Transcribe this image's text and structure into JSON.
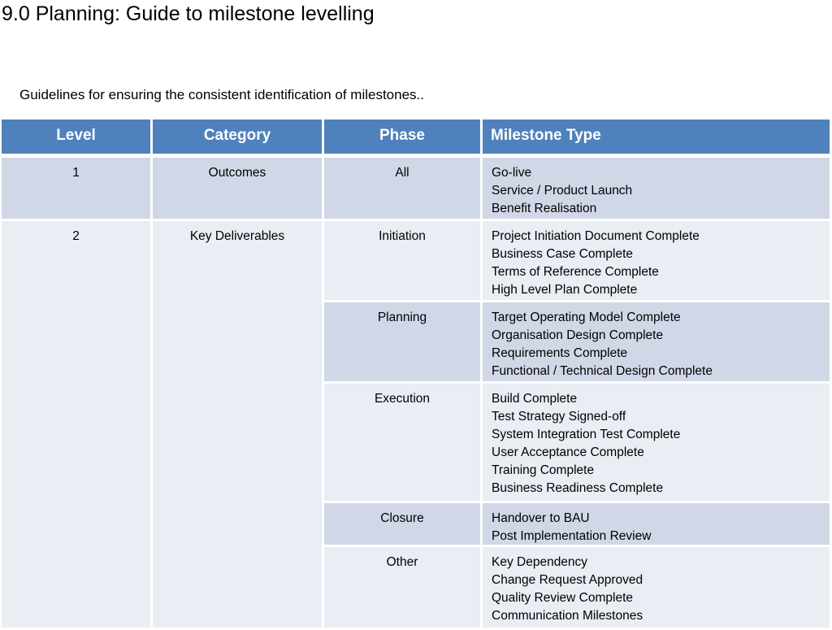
{
  "title": "9.0 Planning: Guide to milestone levelling",
  "subtitle": "Guidelines for ensuring the consistent identification of milestones..",
  "table": {
    "headers": [
      "Level",
      "Category",
      "Phase",
      "Milestone Type"
    ],
    "row1": {
      "level": "1",
      "category": "Outcomes",
      "phase": "All",
      "milestones": [
        "Go-live",
        "Service / Product Launch",
        "Benefit Realisation"
      ]
    },
    "row2": {
      "level": "2",
      "category": "Key Deliverables",
      "phases": [
        {
          "phase": "Initiation",
          "milestones": [
            "Project Initiation Document Complete",
            "Business Case Complete",
            "Terms of Reference Complete",
            "High Level Plan Complete"
          ]
        },
        {
          "phase": "Planning",
          "milestones": [
            "Target Operating Model Complete",
            "Organisation Design Complete",
            "Requirements Complete",
            "Functional / Technical Design Complete"
          ]
        },
        {
          "phase": "Execution",
          "milestones": [
            "Build Complete",
            "Test Strategy Signed-off",
            "System Integration Test Complete",
            "User Acceptance Complete",
            "Training Complete",
            "Business Readiness Complete"
          ]
        },
        {
          "phase": "Closure",
          "milestones": [
            "Handover to BAU",
            "Post Implementation Review"
          ]
        },
        {
          "phase": "Other",
          "milestones": [
            "Key Dependency",
            "Change Request Approved",
            "Quality Review Complete",
            "Communication Milestones"
          ]
        }
      ]
    }
  },
  "colors": {
    "header": "#4f81bd",
    "band_dark": "#d0d8e8",
    "band_light": "#e9edf4"
  }
}
